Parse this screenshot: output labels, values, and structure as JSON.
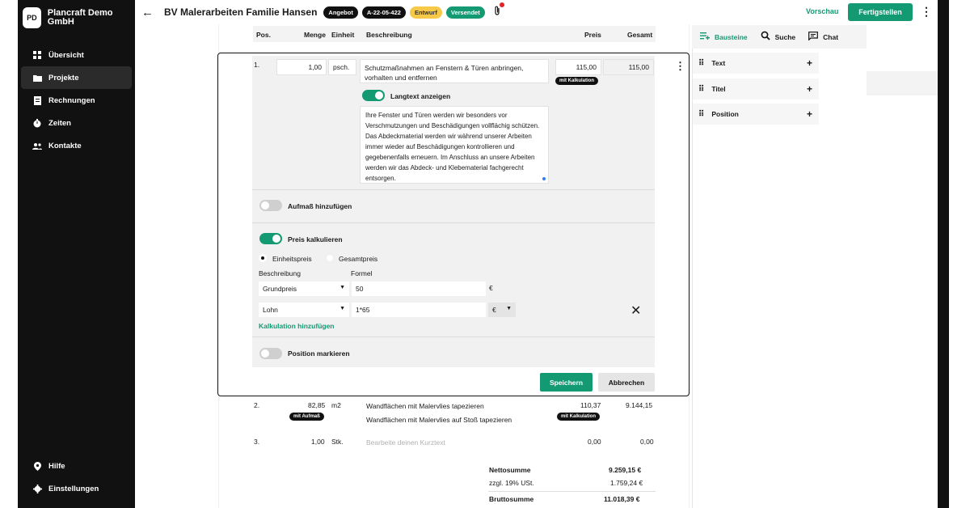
{
  "sidebar": {
    "logo": "PD",
    "company": "Plancraft Demo GmbH",
    "items": [
      {
        "label": "Übersicht",
        "icon": "grid-icon"
      },
      {
        "label": "Projekte",
        "icon": "folder-icon"
      },
      {
        "label": "Rechnungen",
        "icon": "invoice-icon"
      },
      {
        "label": "Zeiten",
        "icon": "stopwatch-icon"
      },
      {
        "label": "Kontakte",
        "icon": "people-icon"
      }
    ],
    "bottom": [
      {
        "label": "Hilfe",
        "icon": "location-icon"
      },
      {
        "label": "Einstellungen",
        "icon": "gear-icon"
      }
    ]
  },
  "header": {
    "title": "BV Malerarbeiten Familie Hansen",
    "badges": [
      "Angebot",
      "A-22-05-422",
      "Entwurf",
      "Versendet"
    ],
    "preview": "Vorschau",
    "finish": "Fertigstellen"
  },
  "table": {
    "headers": {
      "pos": "Pos.",
      "menge": "Menge",
      "einheit": "Einheit",
      "beschreibung": "Beschreibung",
      "preis": "Preis",
      "gesamt": "Gesamt"
    }
  },
  "edit": {
    "pos": "1.",
    "menge": "1,00",
    "einheit": "psch.",
    "kurztext": "Schutzmaßnahmen an Fenstern & Türen anbringen, vorhalten und entfernen",
    "preis": "115,00",
    "gesamt": "115,00",
    "kalk_pill": "mit Kalkulation",
    "langtext_label": "Langtext anzeigen",
    "langtext": "Ihre Fenster und Türen werden wir besonders vor Verschmutzungen und Beschädigungen vollflächig schützen. Das Abdeckmaterial werden wir während unserer Arbeiten immer wieder auf Beschädigungen kontrollieren und gegebenenfalls erneuern. Im Anschluss an unsere Arbeiten werden wir das Abdeck- und Klebematerial fachgerecht entsorgen.",
    "aufmass_label": "Aufmaß hinzufügen",
    "preis_kalk_label": "Preis kalkulieren",
    "radio_einheit": "Einheitspreis",
    "radio_gesamt": "Gesamtpreis",
    "col_beschreibung": "Beschreibung",
    "col_formel": "Formel",
    "calc_rows": [
      {
        "desc": "Grundpreis",
        "formel": "50",
        "unit": "€"
      },
      {
        "desc": "Lohn",
        "formel": "1*65",
        "unit": "€"
      }
    ],
    "add_calc": "Kalkulation hinzufügen",
    "mark_label": "Position markieren",
    "save": "Speichern",
    "cancel": "Abbrechen"
  },
  "positions": [
    {
      "pos": "2.",
      "menge": "82,85",
      "einheit": "m2",
      "kurztext": "Wandflächen mit Malervlies tapezieren",
      "langtext": "Wandflächen mit Malervlies auf Stoß tapezieren",
      "preis": "110,37",
      "gesamt": "9.144,15",
      "pill_left": "mit Aufmaß",
      "pill_right": "mit Kalkulation"
    },
    {
      "pos": "3.",
      "menge": "1,00",
      "einheit": "Stk.",
      "placeholder": "Bearbeite deinen Kurztext",
      "preis": "0,00",
      "gesamt": "0,00"
    }
  ],
  "totals": {
    "netto_label": "Nettosumme",
    "netto": "9.259,15 €",
    "ust_label": "zzgl. 19% USt.",
    "ust": "1.759,24 €",
    "brutto_label": "Bruttosumme",
    "brutto": "11.018,39 €"
  },
  "right_panel": {
    "tabs": [
      {
        "label": "Bausteine",
        "icon": "blocks-icon"
      },
      {
        "label": "Suche",
        "icon": "search-icon"
      },
      {
        "label": "Chat",
        "icon": "chat-icon"
      }
    ],
    "items": [
      "Text",
      "Titel",
      "Position"
    ]
  }
}
